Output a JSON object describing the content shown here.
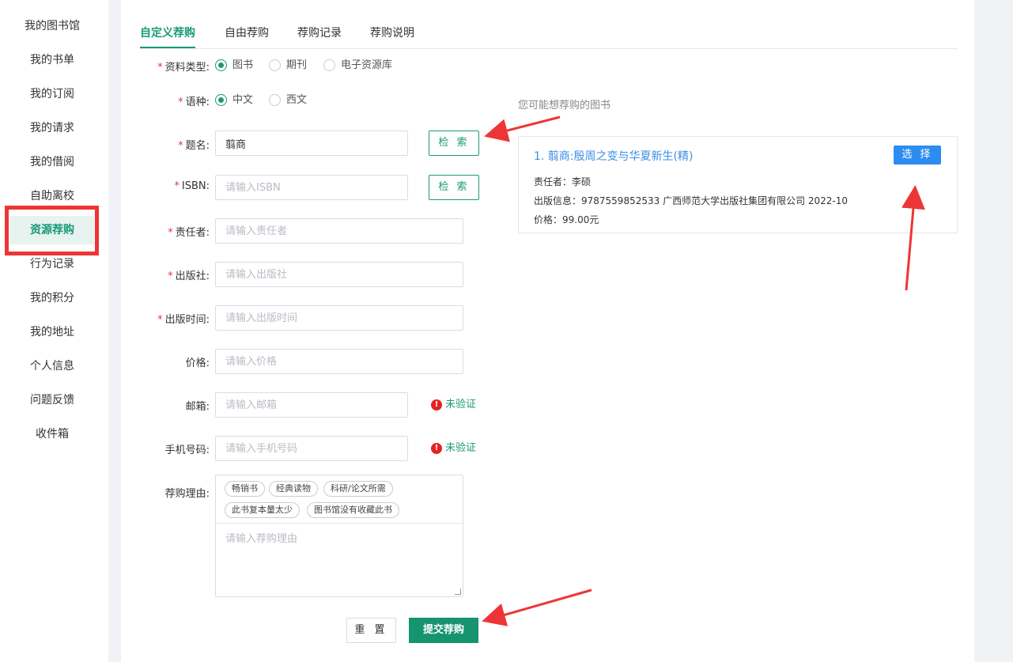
{
  "sidebar": {
    "items": [
      {
        "label": "我的图书馆"
      },
      {
        "label": "我的书单"
      },
      {
        "label": "我的订阅"
      },
      {
        "label": "我的请求"
      },
      {
        "label": "我的借阅"
      },
      {
        "label": "自助离校"
      },
      {
        "label": "资源荐购",
        "active": true
      },
      {
        "label": "行为记录"
      },
      {
        "label": "我的积分"
      },
      {
        "label": "我的地址"
      },
      {
        "label": "个人信息"
      },
      {
        "label": "问题反馈"
      },
      {
        "label": "收件箱"
      }
    ]
  },
  "tabs": [
    {
      "label": "自定义荐购",
      "active": true
    },
    {
      "label": "自由荐购"
    },
    {
      "label": "荐购记录"
    },
    {
      "label": "荐购说明"
    }
  ],
  "form": {
    "required_mark": "*",
    "material_type": {
      "label": "资料类型:",
      "options": [
        "图书",
        "期刊",
        "电子资源库"
      ],
      "selected": "图书"
    },
    "language": {
      "label": "语种:",
      "options": [
        "中文",
        "西文"
      ],
      "selected": "中文"
    },
    "title": {
      "label": "题名:",
      "value": "翦商",
      "search_label": "检 索"
    },
    "isbn": {
      "label": "ISBN:",
      "placeholder": "请输入ISBN",
      "search_label": "检 索"
    },
    "author": {
      "label": "责任者:",
      "placeholder": "请输入责任者"
    },
    "publisher": {
      "label": "出版社:",
      "placeholder": "请输入出版社"
    },
    "pub_date": {
      "label": "出版时间:",
      "placeholder": "请输入出版时间"
    },
    "price": {
      "label": "价格:",
      "placeholder": "请输入价格"
    },
    "email": {
      "label": "邮箱:",
      "placeholder": "请输入邮箱",
      "status": "未验证"
    },
    "phone": {
      "label": "手机号码:",
      "placeholder": "请输入手机号码",
      "status": "未验证"
    },
    "reason": {
      "label": "荐购理由:",
      "tags": [
        "畅销书",
        "经典读物",
        "科研/论文所需",
        "此书复本量太少",
        "图书馆没有收藏此书"
      ],
      "placeholder": "请输入荐购理由"
    },
    "reset_label": "重 置",
    "submit_label": "提交荐购"
  },
  "suggestions": {
    "title": "您可能想荐购的图书",
    "books": [
      {
        "title": "1. 翦商:殷周之变与华夏新生(精)",
        "select_label": "选 择",
        "author_line": "责任者：李硕",
        "pub_line": "出版信息：9787559852533  广西师范大学出版社集团有限公司  2022-10",
        "price_line": "价格：99.00元"
      }
    ]
  },
  "colors": {
    "accent": "#1a9a76",
    "link": "#3a8ee6",
    "select_button": "#2d8cf0",
    "annotation": "#ee3535",
    "required": "#e03a3a"
  }
}
